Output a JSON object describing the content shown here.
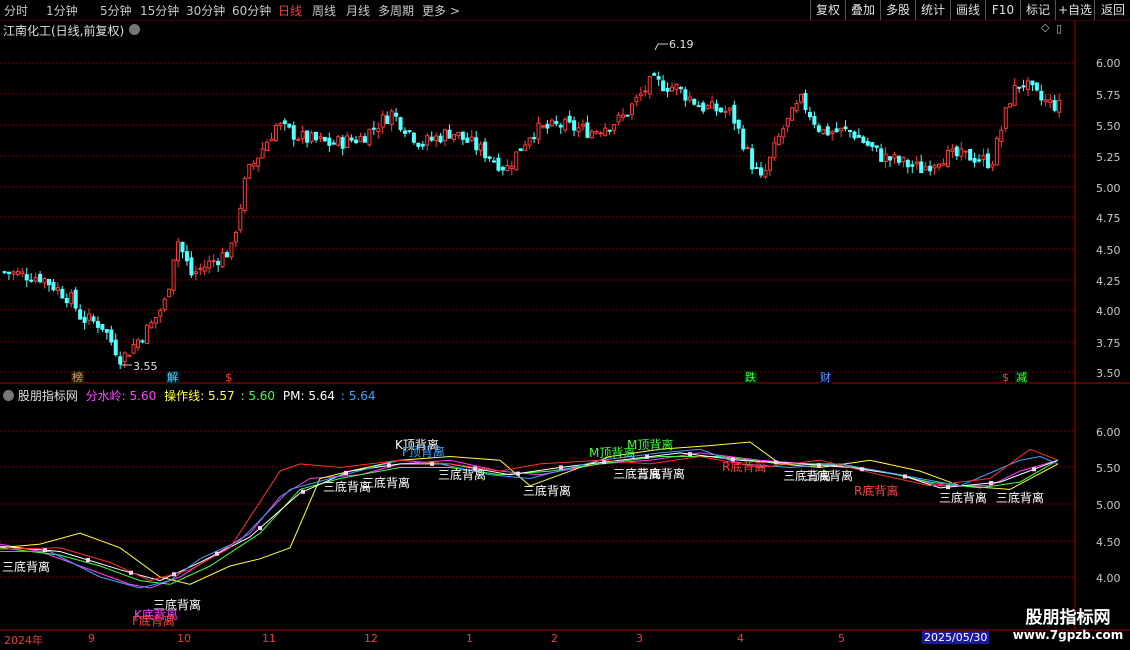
{
  "toolbar": {
    "timeframes": [
      "分时",
      "1分钟",
      "5分钟",
      "15分钟",
      "30分钟",
      "60分钟",
      "日线",
      "周线",
      "月线",
      "多周期",
      "更多 >"
    ],
    "active_timeframe": "日线",
    "buttons": [
      "复权",
      "叠加",
      "多股",
      "统计",
      "画线",
      "F10",
      "+自选",
      "返回",
      "标记"
    ]
  },
  "main_panel": {
    "title": "江南化工(日线,前复权)",
    "y_ticks": [
      "6.00",
      "5.75",
      "5.50",
      "5.25",
      "5.00",
      "4.75",
      "4.50",
      "4.25",
      "4.00",
      "3.75",
      "3.50"
    ],
    "high_label": "6.19",
    "low_label": "3.55",
    "badges": [
      {
        "text": "榜",
        "color": "#d0a070",
        "bg": "#2a1a00"
      },
      {
        "text": "解",
        "color": "#60d0ff",
        "bg": "#00202a"
      },
      {
        "text": "$",
        "color": "#ff4040",
        "bg": "#000"
      },
      {
        "text": "跌",
        "color": "#40ff40",
        "bg": "#002000"
      },
      {
        "text": "财",
        "color": "#60a0ff",
        "bg": "#000020"
      },
      {
        "text": "$",
        "color": "#ff4040",
        "bg": "#000"
      },
      {
        "text": "减",
        "color": "#40ff40",
        "bg": "#002000"
      }
    ]
  },
  "indicator_panel": {
    "name": "股朋指标网",
    "legend": [
      {
        "label": "分水岭: ",
        "value": "5.60",
        "color": "#ff40ff"
      },
      {
        "label": "操作线: ",
        "value": "5.57",
        "color": "#ffff40"
      },
      {
        "label": ": ",
        "value": "5.60",
        "color": "#40ff40"
      },
      {
        "label": "PM: ",
        "value": "5.64",
        "color": "#ffffff"
      },
      {
        "label": ": ",
        "value": "5.64",
        "color": "#40a0ff"
      }
    ],
    "y_ticks": [
      "6.00",
      "5.50",
      "5.00",
      "4.50",
      "4.00"
    ],
    "signals": [
      {
        "text": "三底背离",
        "color": "#ffffff"
      },
      {
        "text": "三底背离",
        "color": "#ffffff"
      },
      {
        "text": "K底背离",
        "color": "#ff40ff"
      },
      {
        "text": "F底背离",
        "color": "#ff4040"
      },
      {
        "text": "K顶背离",
        "color": "#ffffff"
      },
      {
        "text": "F顶背离",
        "color": "#40a0ff"
      },
      {
        "text": "三底背离",
        "color": "#ffffff"
      },
      {
        "text": "三底背离",
        "color": "#ffffff"
      },
      {
        "text": "三底背离",
        "color": "#ffffff"
      },
      {
        "text": "三底背离",
        "color": "#ffffff"
      },
      {
        "text": "M顶背离",
        "color": "#40ff40"
      },
      {
        "text": "M顶背离",
        "color": "#40ff40"
      },
      {
        "text": "三底背离",
        "color": "#ffffff"
      },
      {
        "text": "三底背离",
        "color": "#ffffff"
      },
      {
        "text": "R底背离",
        "color": "#ff4040"
      },
      {
        "text": "三底背离",
        "color": "#ffffff"
      },
      {
        "text": "三底背离",
        "color": "#ffffff"
      },
      {
        "text": "R底背离",
        "color": "#ff4040"
      },
      {
        "text": "三底背离",
        "color": "#ffffff"
      },
      {
        "text": "三底背离",
        "color": "#ffffff"
      }
    ]
  },
  "time_axis": {
    "labels": [
      "2024年",
      "9",
      "10",
      "11",
      "12",
      "1",
      "2",
      "3",
      "4",
      "5"
    ],
    "cursor_date": "2025/05/30"
  },
  "watermark": {
    "title": "股朋指标网",
    "url": "www.7gpzb.com"
  },
  "colors": {
    "up": "#ff3b3b",
    "down": "#54ffff",
    "grid": "#8b0000",
    "frame": "#b00000"
  }
}
